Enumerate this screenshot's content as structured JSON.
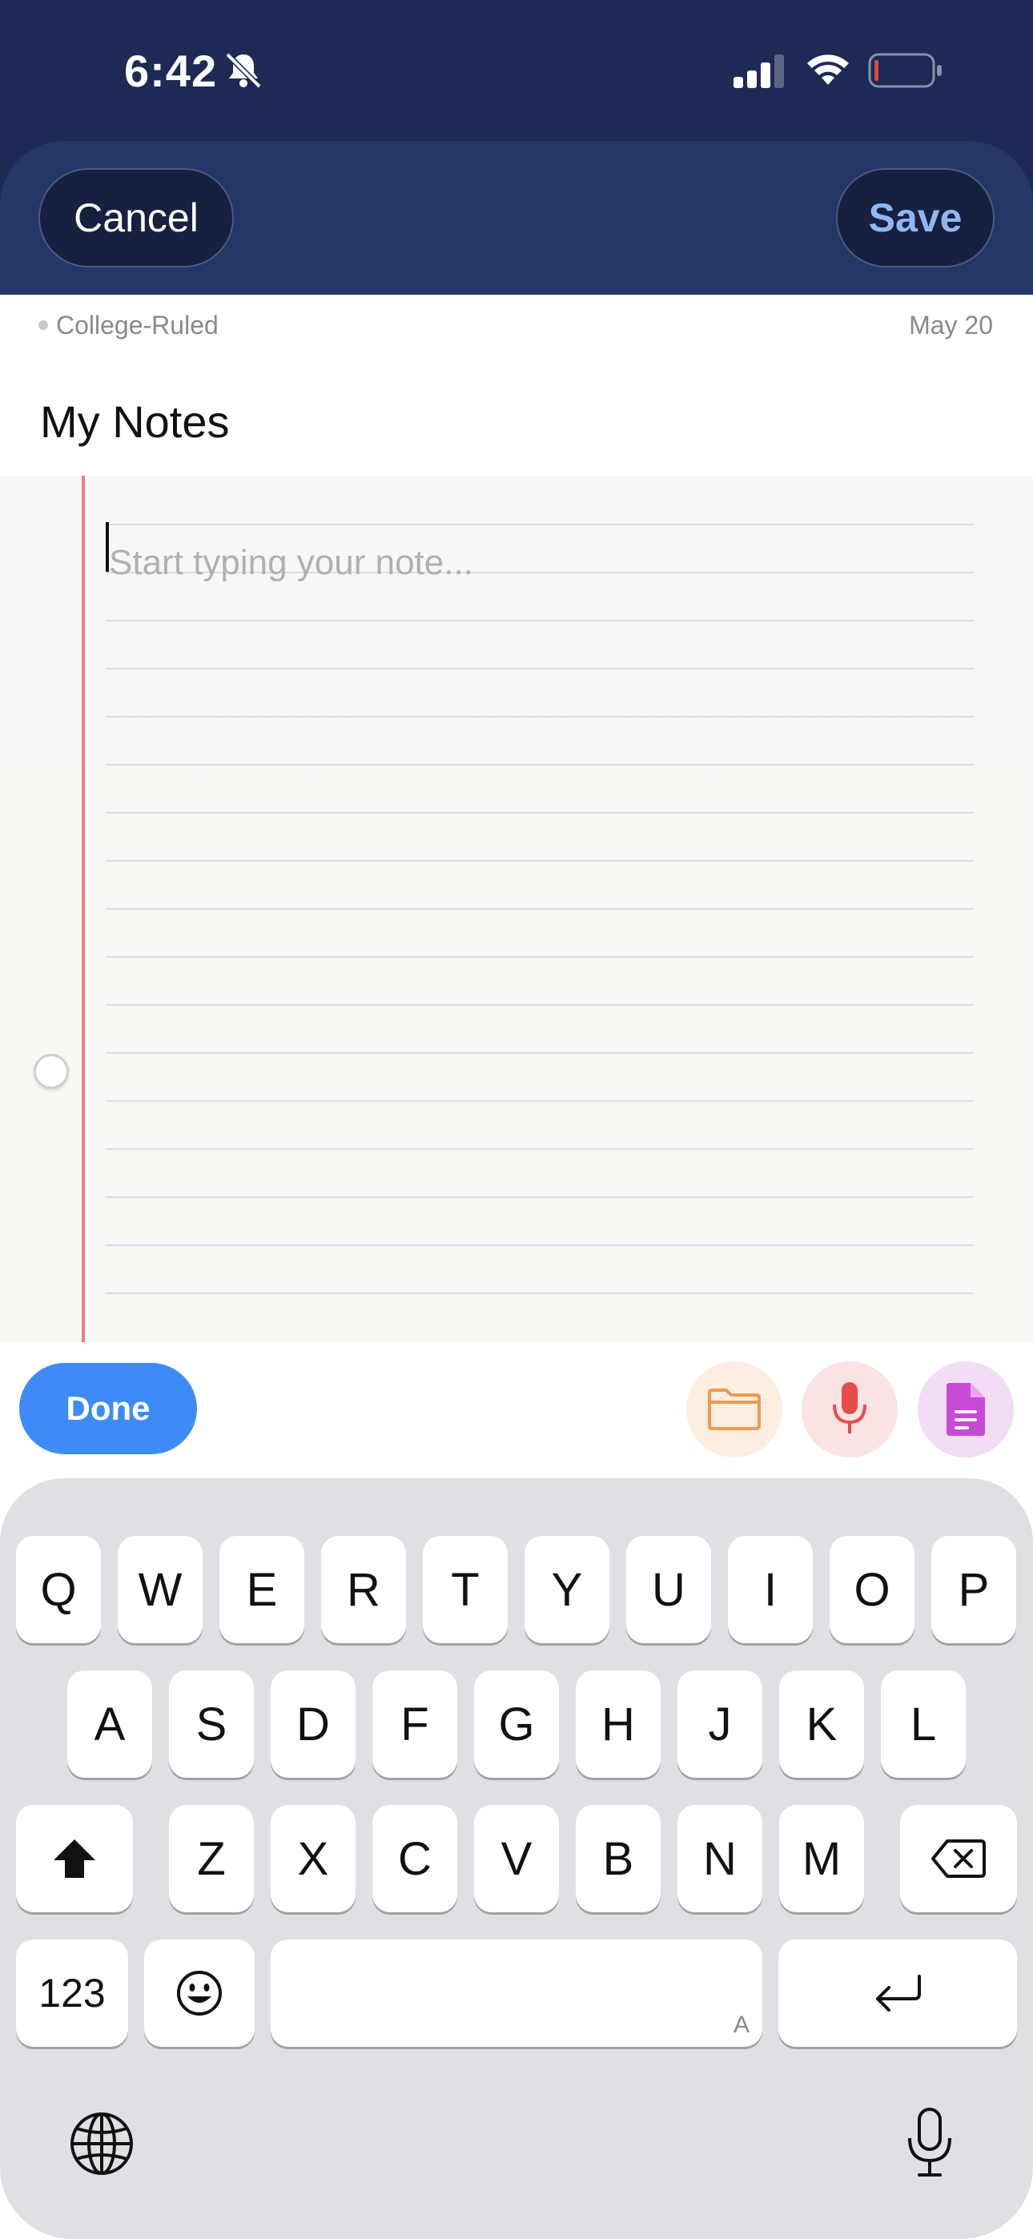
{
  "status_bar": {
    "time": "6:42",
    "icons": [
      "bell-slash-icon",
      "signal-icon",
      "wifi-icon",
      "battery-icon"
    ]
  },
  "nav": {
    "cancel_label": "Cancel",
    "save_label": "Save"
  },
  "meta": {
    "paper_type": "College-Ruled",
    "date": "May 20"
  },
  "note": {
    "title": "My Notes",
    "placeholder": "Start typing your note..."
  },
  "toolbar": {
    "done_label": "Done",
    "tools": [
      "folder-icon",
      "microphone-icon",
      "document-icon"
    ]
  },
  "keyboard": {
    "row1": [
      "Q",
      "W",
      "E",
      "R",
      "T",
      "Y",
      "U",
      "I",
      "O",
      "P"
    ],
    "row2": [
      "A",
      "S",
      "D",
      "F",
      "G",
      "H",
      "J",
      "K",
      "L"
    ],
    "row3": [
      "Z",
      "X",
      "C",
      "V",
      "B",
      "N",
      "M"
    ],
    "numbers_label": "123",
    "space_mark": "A"
  },
  "colors": {
    "header": "#1d2a55",
    "accent": "#3e8bf7",
    "save_text": "#8fb7f1",
    "margin_line": "#ec7f7e",
    "rule_line": "#d1e1f0"
  }
}
